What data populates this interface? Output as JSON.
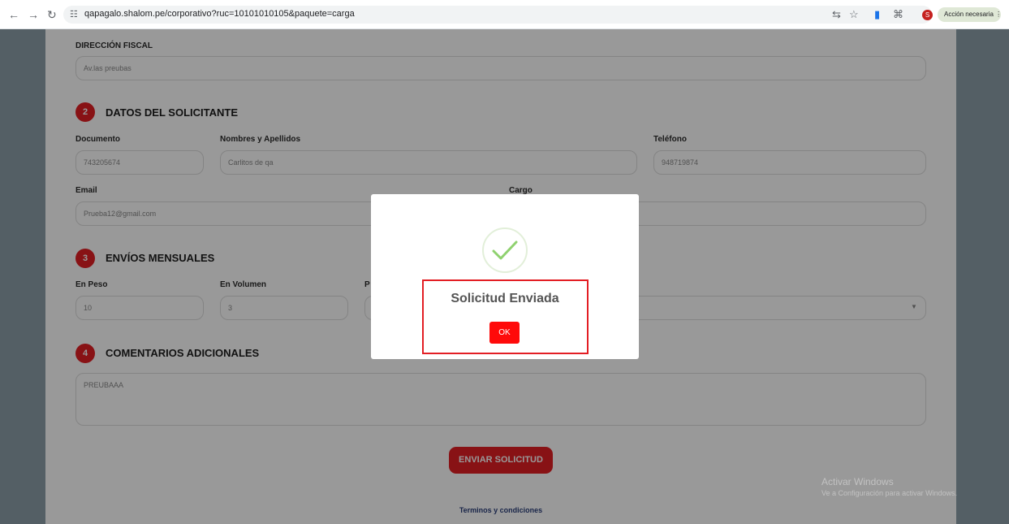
{
  "browser": {
    "url": "qapagalo.shalom.pe/corporativo?ruc=10101010105&paquete=carga",
    "profile_initial": "S",
    "action_label": "Acción necesaria"
  },
  "form": {
    "fiscal": {
      "label": "DIRECCIÓN FISCAL",
      "value": "Av.las preubas"
    },
    "section2": {
      "number": "2",
      "title": "DATOS DEL SOLICITANTE",
      "documento": {
        "label": "Documento",
        "value": "743205674"
      },
      "nombres": {
        "label": "Nombres y Apellidos",
        "value": "Carlitos de qa"
      },
      "telefono": {
        "label": "Teléfono",
        "value": "948719874"
      },
      "email": {
        "label": "Email",
        "value": "Prueba12@gmail.com"
      },
      "cargo": {
        "label": "Cargo",
        "value": ""
      }
    },
    "section3": {
      "number": "3",
      "title": "ENVÍOS MENSUALES",
      "peso": {
        "label": "En Peso",
        "value": "10"
      },
      "volumen": {
        "label": "En Volumen",
        "value": "3"
      },
      "partial_label": "P"
    },
    "section4": {
      "number": "4",
      "title": "COMENTARIOS ADICIONALES",
      "comentario": {
        "value": "PREUBAAA"
      }
    },
    "submit_label": "ENVIAR SOLICITUD",
    "terms_label": "Terminos y condiciones"
  },
  "modal": {
    "title": "Solicitud Enviada",
    "ok_label": "OK",
    "icon": "check-circle-icon"
  },
  "watermark": {
    "line1": "Activar Windows",
    "line2": "Ve a Configuración para activar Windows."
  },
  "colors": {
    "brand_red": "#e31e24",
    "ok_red": "#ff0a0a",
    "success_green": "#8fd16f"
  }
}
